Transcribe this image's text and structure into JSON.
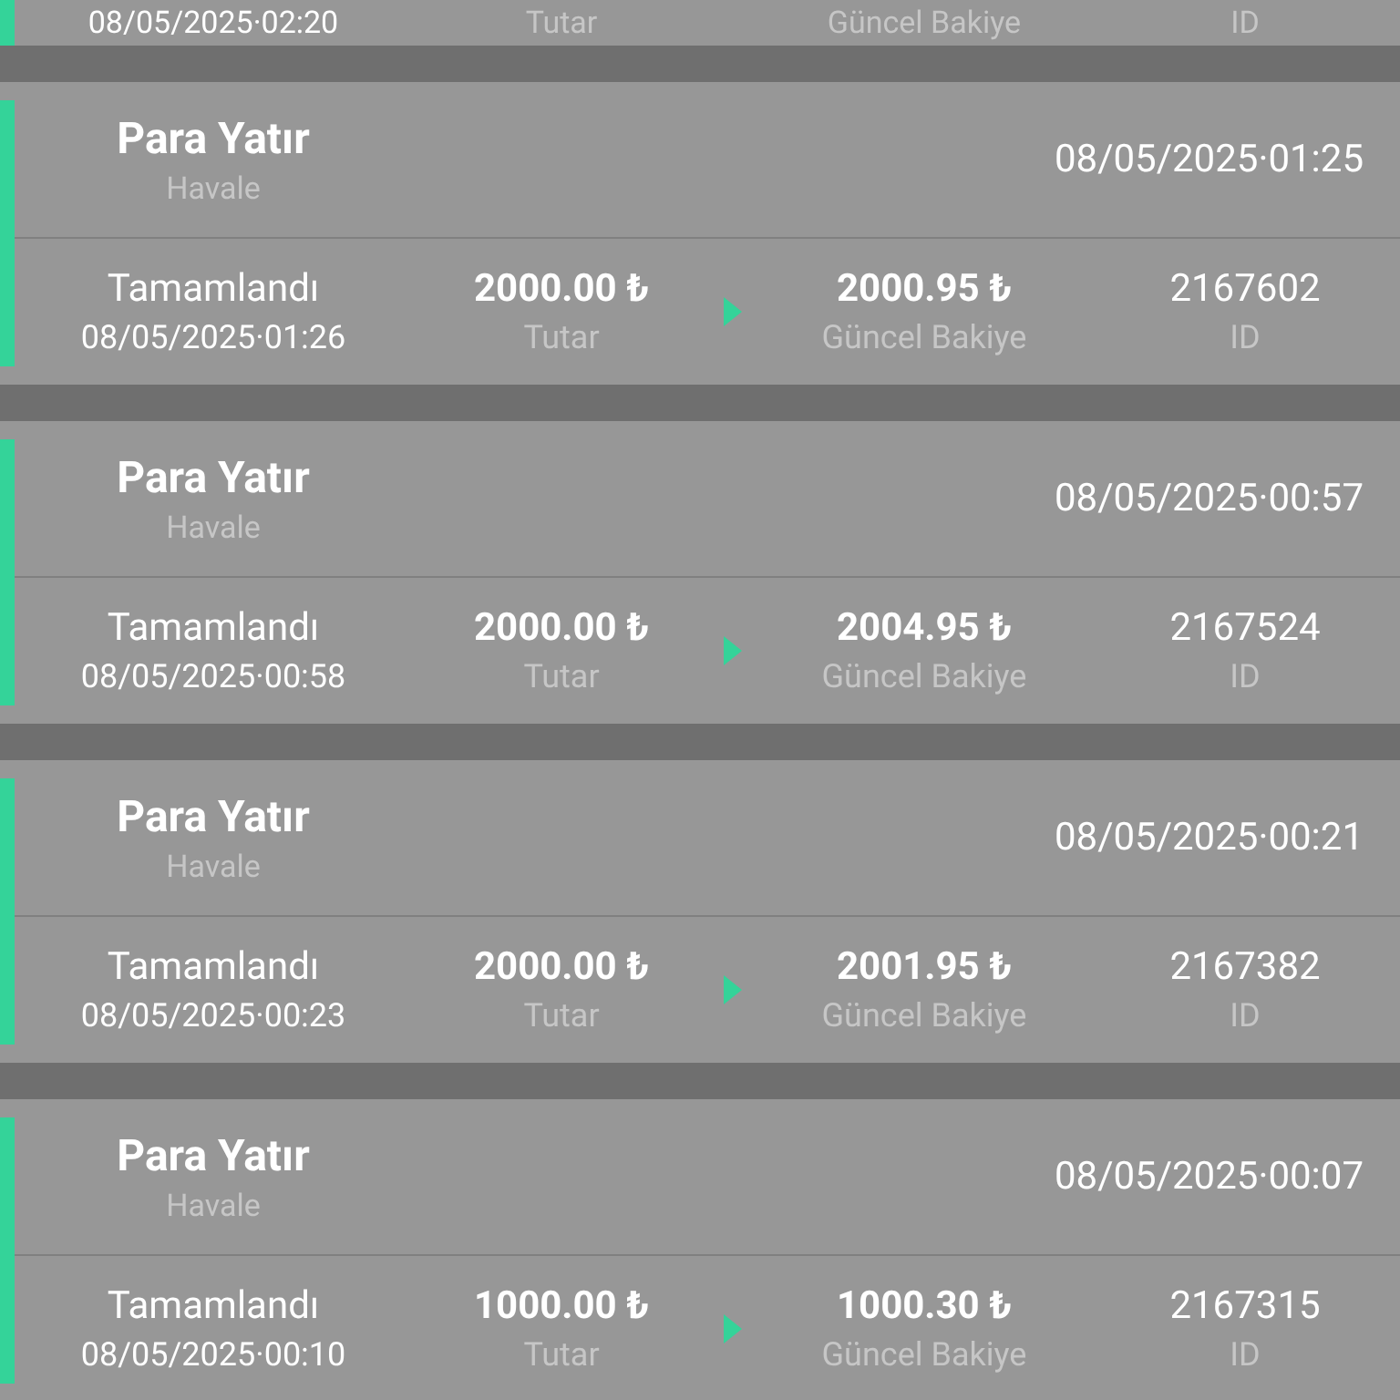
{
  "partial_row": {
    "status_time": "08/05/2025·02:20",
    "amount_label": "Tutar",
    "balance_label": "Güncel Bakiye",
    "id_label": "ID"
  },
  "transactions": [
    {
      "title": "Para Yatır",
      "method": "Havale",
      "date": "08/05/2025·01:25",
      "status": "Tamamlandı",
      "status_time": "08/05/2025·01:26",
      "amount": "2000.00 ₺",
      "amount_label": "Tutar",
      "balance": "2000.95 ₺",
      "balance_label": "Güncel Bakiye",
      "id": "2167602",
      "id_label": "ID"
    },
    {
      "title": "Para Yatır",
      "method": "Havale",
      "date": "08/05/2025·00:57",
      "status": "Tamamlandı",
      "status_time": "08/05/2025·00:58",
      "amount": "2000.00 ₺",
      "amount_label": "Tutar",
      "balance": "2004.95 ₺",
      "balance_label": "Güncel Bakiye",
      "id": "2167524",
      "id_label": "ID"
    },
    {
      "title": "Para Yatır",
      "method": "Havale",
      "date": "08/05/2025·00:21",
      "status": "Tamamlandı",
      "status_time": "08/05/2025·00:23",
      "amount": "2000.00 ₺",
      "amount_label": "Tutar",
      "balance": "2001.95 ₺",
      "balance_label": "Güncel Bakiye",
      "id": "2167382",
      "id_label": "ID"
    },
    {
      "title": "Para Yatır",
      "method": "Havale",
      "date": "08/05/2025·00:07",
      "status": "Tamamlandı",
      "status_time": "08/05/2025·00:10",
      "amount": "1000.00 ₺",
      "amount_label": "Tutar",
      "balance": "1000.30 ₺",
      "balance_label": "Güncel Bakiye",
      "id": "2167315",
      "id_label": "ID"
    }
  ]
}
